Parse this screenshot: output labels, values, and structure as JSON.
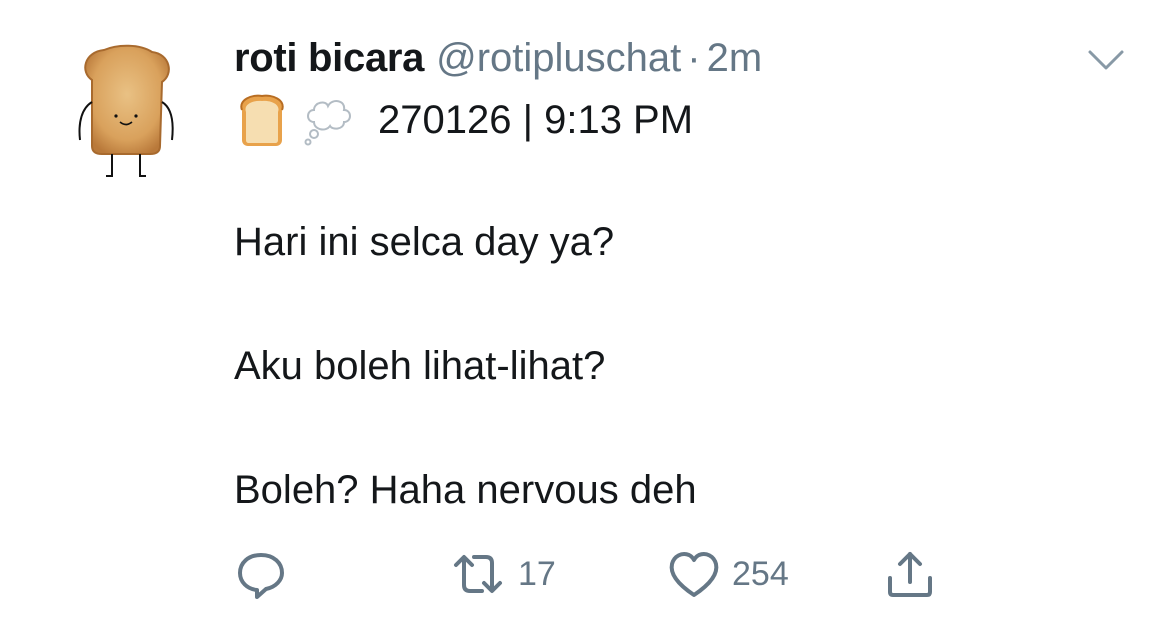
{
  "tweet": {
    "display_name": "roti bicara",
    "handle": "@rotipluschat",
    "separator": "·",
    "time": "2m",
    "subline": "270126 | 9:13 PM",
    "lines": [
      "Hari ini selca day ya?",
      "Aku boleh lihat-lihat?",
      "Boleh? Haha nervous deh"
    ],
    "retweet_count": "17",
    "like_count": "254",
    "icons": {
      "avatar": "toast-avatar",
      "emoji_1": "bread-emoji",
      "emoji_2": "thought-balloon-emoji",
      "menu": "chevron-down-icon",
      "reply": "reply-icon",
      "retweet": "retweet-icon",
      "like": "heart-icon",
      "share": "share-icon"
    },
    "colors": {
      "text": "#14171a",
      "secondary": "#657786",
      "icon": "#657786"
    }
  }
}
